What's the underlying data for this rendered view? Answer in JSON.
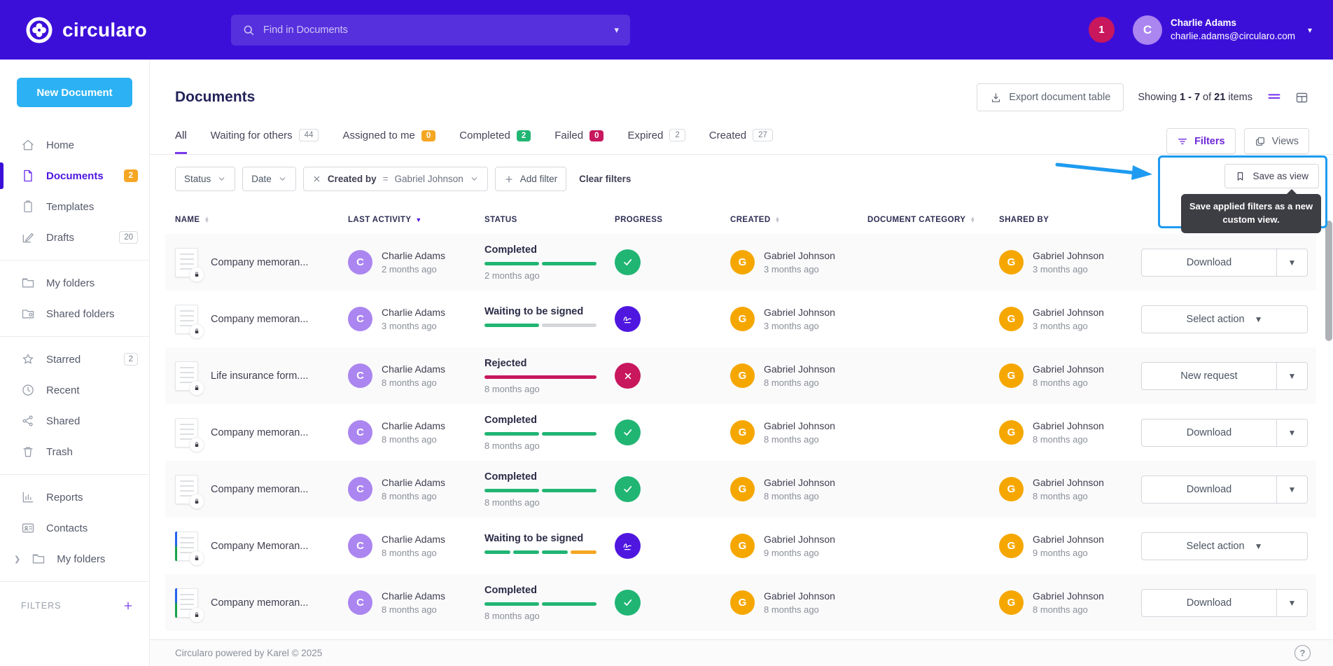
{
  "accent_colors": {
    "topbar": "#3c0fd9",
    "primary_purple": "#7c3aed",
    "highlight_blue": "#1e9bf0",
    "green": "#21b573",
    "crimson": "#c8175d",
    "orange": "#f5a623",
    "sign_purple": "#4f16e0",
    "gray_segment": "#d4d6da",
    "charlie_avatar": "#ab85f0",
    "gabriel_avatar": "#f5a700"
  },
  "topbar": {
    "brand": "circularo",
    "search_placeholder": "Find in Documents",
    "notification_count": "1",
    "user": {
      "name": "Charlie Adams",
      "email": "charlie.adams@circularo.com",
      "avatar_initial": "C"
    }
  },
  "sidebar": {
    "new_document_label": "New Document",
    "items": [
      {
        "icon": "home",
        "label": "Home"
      },
      {
        "icon": "file",
        "label": "Documents",
        "badge": "2",
        "badge_style": "orange",
        "active": true
      },
      {
        "icon": "clipboard",
        "label": "Templates"
      },
      {
        "icon": "drafts",
        "label": "Drafts",
        "badge": "20",
        "badge_style": "outline",
        "divider_after": true
      },
      {
        "icon": "folder",
        "label": "My folders"
      },
      {
        "icon": "folder-shared",
        "label": "Shared folders",
        "divider_after": true
      },
      {
        "icon": "star",
        "label": "Starred",
        "badge": "2",
        "badge_style": "outline"
      },
      {
        "icon": "clock",
        "label": "Recent"
      },
      {
        "icon": "share",
        "label": "Shared"
      },
      {
        "icon": "trash",
        "label": "Trash",
        "divider_after": true
      },
      {
        "icon": "chart",
        "label": "Reports"
      },
      {
        "icon": "contact",
        "label": "Contacts"
      },
      {
        "icon": "folder",
        "label": "My folders",
        "chevron": true,
        "divider_after": true
      }
    ],
    "filters_label": "FILTERS"
  },
  "page_head": {
    "title": "Documents",
    "export_label": "Export document table",
    "showing": {
      "prefix": "Showing",
      "range": "1 - 7",
      "of": "of",
      "total": "21",
      "suffix": "items"
    }
  },
  "tabs": [
    {
      "label": "All",
      "active": true
    },
    {
      "label": "Waiting for others",
      "count": "44",
      "badge": "muted"
    },
    {
      "label": "Assigned to me",
      "count": "0",
      "badge": "orange"
    },
    {
      "label": "Completed",
      "count": "2",
      "badge": "green"
    },
    {
      "label": "Failed",
      "count": "0",
      "badge": "crimson"
    },
    {
      "label": "Expired",
      "count": "2",
      "badge": "muted"
    },
    {
      "label": "Created",
      "count": "27",
      "badge": "muted"
    }
  ],
  "tabs_right": {
    "filters_label": "Filters",
    "views_label": "Views"
  },
  "filter_bar": {
    "chips": [
      {
        "type": "select",
        "label": "Status"
      },
      {
        "type": "select",
        "label": "Date"
      },
      {
        "type": "applied",
        "label": "Created by",
        "operator": "=",
        "value": "Gabriel Johnson"
      },
      {
        "type": "add",
        "label": "Add filter"
      }
    ],
    "clear_label": "Clear filters"
  },
  "save_view": {
    "button_label": "Save as view",
    "tooltip": "Save applied filters as a new custom view."
  },
  "table": {
    "columns": [
      {
        "label": "NAME",
        "sort": "both"
      },
      {
        "label": "LAST ACTIVITY",
        "sort": "desc"
      },
      {
        "label": "STATUS"
      },
      {
        "label": "PROGRESS"
      },
      {
        "label": "CREATED",
        "sort": "both"
      },
      {
        "label": "DOCUMENT CATEGORY",
        "sort": "both"
      },
      {
        "label": "SHARED BY"
      },
      {
        "label": ""
      }
    ],
    "rows": [
      {
        "name": "Company memoran...",
        "thumb": "plain",
        "last": {
          "user": "Charlie Adams",
          "initial": "C",
          "time": "2 months ago"
        },
        "status": {
          "label": "Completed",
          "time": "2 months ago",
          "segments": [
            "green",
            "green"
          ]
        },
        "state": "completed",
        "created": {
          "user": "Gabriel Johnson",
          "initial": "G",
          "time": "3 months ago"
        },
        "category": "",
        "shared": {
          "user": "Gabriel Johnson",
          "initial": "G",
          "time": "3 months ago"
        },
        "action": {
          "label": "Download",
          "split": true
        }
      },
      {
        "name": "Company memoran...",
        "thumb": "plain",
        "last": {
          "user": "Charlie Adams",
          "initial": "C",
          "time": "3 months ago"
        },
        "status": {
          "label": "Waiting to be signed",
          "time": "",
          "segments": [
            "green",
            "gray"
          ]
        },
        "state": "waiting",
        "created": {
          "user": "Gabriel Johnson",
          "initial": "G",
          "time": "3 months ago"
        },
        "category": "",
        "shared": {
          "user": "Gabriel Johnson",
          "initial": "G",
          "time": "3 months ago"
        },
        "action": {
          "label": "Select action",
          "split": false
        }
      },
      {
        "name": "Life insurance form....",
        "thumb": "plain",
        "last": {
          "user": "Charlie Adams",
          "initial": "C",
          "time": "8 months ago"
        },
        "status": {
          "label": "Rejected",
          "time": "8 months ago",
          "segments": [
            "crimson"
          ]
        },
        "state": "rejected",
        "created": {
          "user": "Gabriel Johnson",
          "initial": "G",
          "time": "8 months ago"
        },
        "category": "",
        "shared": {
          "user": "Gabriel Johnson",
          "initial": "G",
          "time": "8 months ago"
        },
        "action": {
          "label": "New request",
          "split": true
        }
      },
      {
        "name": "Company memoran...",
        "thumb": "plain",
        "last": {
          "user": "Charlie Adams",
          "initial": "C",
          "time": "8 months ago"
        },
        "status": {
          "label": "Completed",
          "time": "8 months ago",
          "segments": [
            "green",
            "green"
          ]
        },
        "state": "completed",
        "created": {
          "user": "Gabriel Johnson",
          "initial": "G",
          "time": "8 months ago"
        },
        "category": "",
        "shared": {
          "user": "Gabriel Johnson",
          "initial": "G",
          "time": "8 months ago"
        },
        "action": {
          "label": "Download",
          "split": true
        }
      },
      {
        "name": "Company memoran...",
        "thumb": "plain",
        "last": {
          "user": "Charlie Adams",
          "initial": "C",
          "time": "8 months ago"
        },
        "status": {
          "label": "Completed",
          "time": "8 months ago",
          "segments": [
            "green",
            "green"
          ]
        },
        "state": "completed",
        "created": {
          "user": "Gabriel Johnson",
          "initial": "G",
          "time": "8 months ago"
        },
        "category": "",
        "shared": {
          "user": "Gabriel Johnson",
          "initial": "G",
          "time": "8 months ago"
        },
        "action": {
          "label": "Download",
          "split": true
        }
      },
      {
        "name": "Company Memoran...",
        "thumb": "striped",
        "last": {
          "user": "Charlie Adams",
          "initial": "C",
          "time": "8 months ago"
        },
        "status": {
          "label": "Waiting to be signed",
          "time": "",
          "segments": [
            "green",
            "green",
            "green",
            "orange"
          ]
        },
        "state": "waiting",
        "created": {
          "user": "Gabriel Johnson",
          "initial": "G",
          "time": "9 months ago"
        },
        "category": "",
        "shared": {
          "user": "Gabriel Johnson",
          "initial": "G",
          "time": "9 months ago"
        },
        "action": {
          "label": "Select action",
          "split": false
        }
      },
      {
        "name": "Company memoran...",
        "thumb": "striped",
        "last": {
          "user": "Charlie Adams",
          "initial": "C",
          "time": "8 months ago"
        },
        "status": {
          "label": "Completed",
          "time": "8 months ago",
          "segments": [
            "green",
            "green"
          ]
        },
        "state": "completed",
        "created": {
          "user": "Gabriel Johnson",
          "initial": "G",
          "time": "8 months ago"
        },
        "category": "",
        "shared": {
          "user": "Gabriel Johnson",
          "initial": "G",
          "time": "8 months ago"
        },
        "action": {
          "label": "Download",
          "split": true
        }
      }
    ]
  },
  "footer": {
    "copyright": "Circularo powered by Karel © 2025",
    "help": "?"
  }
}
